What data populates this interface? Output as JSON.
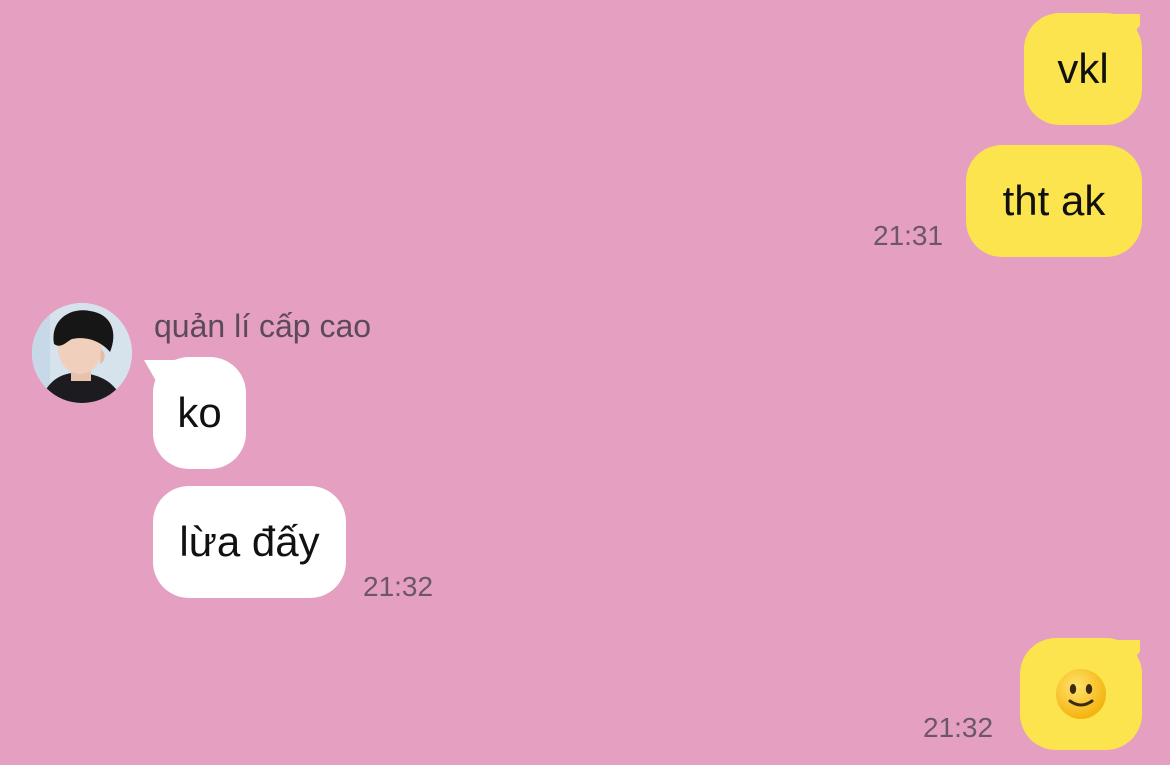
{
  "conversation": {
    "sender_name": "quản lí cấp cao",
    "messages": [
      {
        "direction": "out",
        "text": "vkl",
        "time": ""
      },
      {
        "direction": "out",
        "text": "tht ak",
        "time": "21:31"
      },
      {
        "direction": "in",
        "text": "ko",
        "time": ""
      },
      {
        "direction": "in",
        "text": "lừa đấy",
        "time": "21:32"
      },
      {
        "direction": "out",
        "text": "slightly-smiling-face-emoji",
        "time": "21:32"
      }
    ]
  },
  "colors": {
    "background": "#e59fc0",
    "outgoing_bubble": "#fbe44e",
    "incoming_bubble": "#ffffff",
    "timestamp": "#6b5864"
  },
  "icons": {
    "avatar": "user-avatar-photo",
    "emoji": "slightly-smiling-face-emoji"
  }
}
